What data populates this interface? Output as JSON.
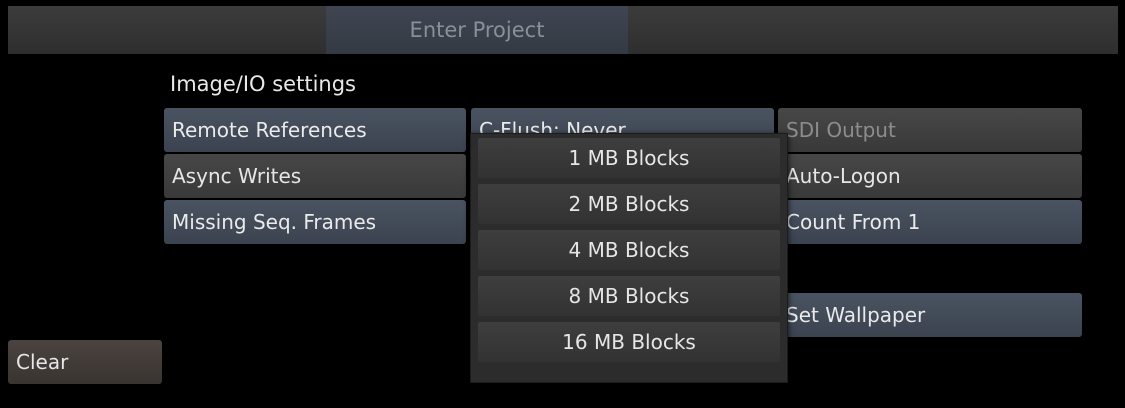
{
  "header": {
    "title": "Enter Project"
  },
  "section": {
    "label": "Image/IO settings"
  },
  "buttons": {
    "remote_references": "Remote References",
    "async_writes": "Async Writes",
    "missing_seq_frames": "Missing Seq. Frames",
    "c_flush": "C-Flush: Never",
    "sdi_output": "SDI Output",
    "auto_logon": "Auto-Logon",
    "count_from_1": "Count From 1",
    "set_wallpaper": "Set Wallpaper",
    "clear": "Clear"
  },
  "dropdown": {
    "options": [
      "1 MB Blocks",
      "2 MB Blocks",
      "4 MB Blocks",
      "8 MB Blocks",
      "16 MB Blocks"
    ]
  },
  "colors": {
    "background": "#000000",
    "button_blue": "#434b58",
    "button_gray": "#404040",
    "title_tab": "#3a404a"
  }
}
